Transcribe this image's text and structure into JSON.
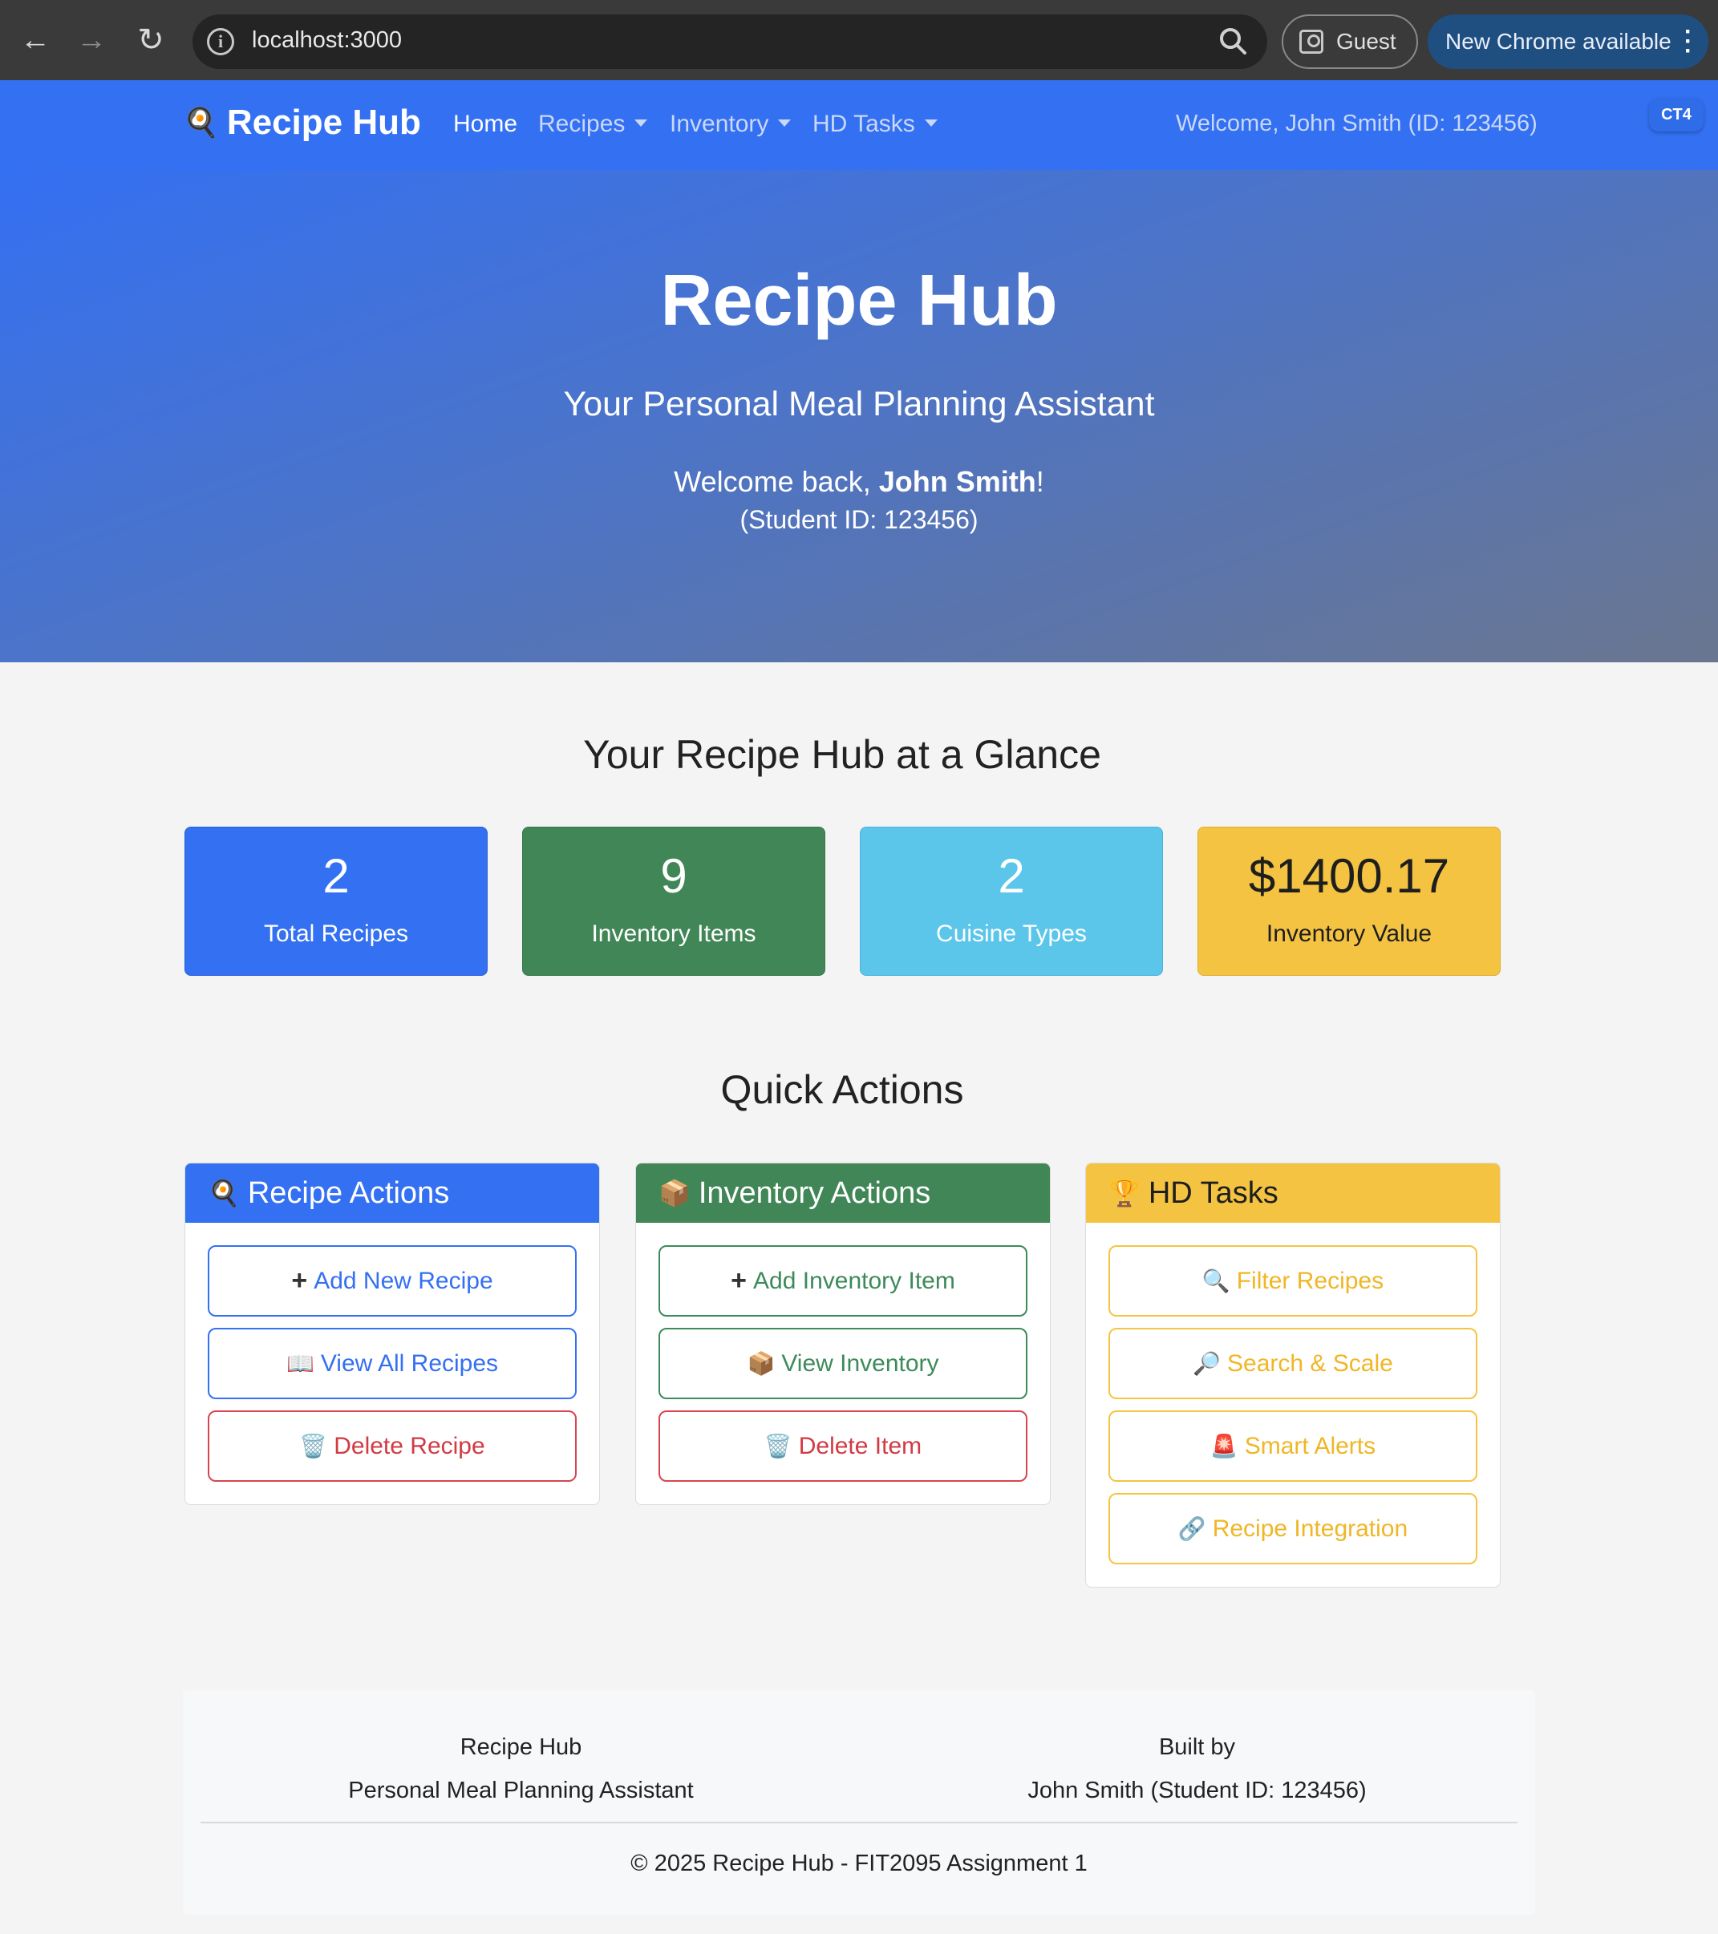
{
  "browser": {
    "url": "localhost:3000",
    "profile_label": "Guest",
    "update_label": "New Chrome available"
  },
  "navbar": {
    "brand_emoji": "🍳",
    "brand": "Recipe Hub",
    "links": [
      {
        "label": "Home",
        "active": true
      },
      {
        "label": "Recipes",
        "dropdown": true
      },
      {
        "label": "Inventory",
        "dropdown": true
      },
      {
        "label": "HD Tasks",
        "dropdown": true
      }
    ],
    "welcome": "Welcome, John Smith (ID: 123456)",
    "badge": "CT4"
  },
  "hero": {
    "title": "Recipe Hub",
    "subtitle": "Your Personal Meal Planning Assistant",
    "welcome_prefix": "Welcome back, ",
    "user_name": "John Smith",
    "welcome_suffix": "!",
    "student_id": "(Student ID: 123456)"
  },
  "glance": {
    "title": "Your Recipe Hub at a Glance",
    "stats": [
      {
        "value": "2",
        "label": "Total Recipes",
        "color": "#3470f2"
      },
      {
        "value": "9",
        "label": "Inventory Items",
        "color": "#418656"
      },
      {
        "value": "2",
        "label": "Cuisine Types",
        "color": "#5bc6ea"
      },
      {
        "value": "$1400.17",
        "label": "Inventory Value",
        "color": "#f5c342"
      }
    ]
  },
  "quick_actions": {
    "title": "Quick Actions",
    "recipe_card": {
      "icon": "🍳",
      "title": "Recipe Actions",
      "buttons": [
        {
          "icon": "+",
          "label": "Add New Recipe"
        },
        {
          "icon": "📖",
          "label": "View All Recipes"
        },
        {
          "icon": "🗑️",
          "label": "Delete Recipe"
        }
      ]
    },
    "inventory_card": {
      "icon": "📦",
      "title": "Inventory Actions",
      "buttons": [
        {
          "icon": "+",
          "label": "Add Inventory Item"
        },
        {
          "icon": "📦",
          "label": "View Inventory"
        },
        {
          "icon": "🗑️",
          "label": "Delete Item"
        }
      ]
    },
    "hd_card": {
      "icon": "🏆",
      "title": "HD Tasks",
      "buttons": [
        {
          "icon": "🔍",
          "label": "Filter Recipes"
        },
        {
          "icon": "🔎",
          "label": "Search & Scale"
        },
        {
          "icon": "🚨",
          "label": "Smart Alerts"
        },
        {
          "icon": "🔗",
          "label": "Recipe Integration"
        }
      ]
    }
  },
  "footer": {
    "left_title": "Recipe Hub",
    "left_sub": "Personal Meal Planning Assistant",
    "right_title": "Built by",
    "right_sub": "John Smith (Student ID: 123456)",
    "copyright": "© 2025 Recipe Hub - FIT2095 Assignment 1"
  }
}
